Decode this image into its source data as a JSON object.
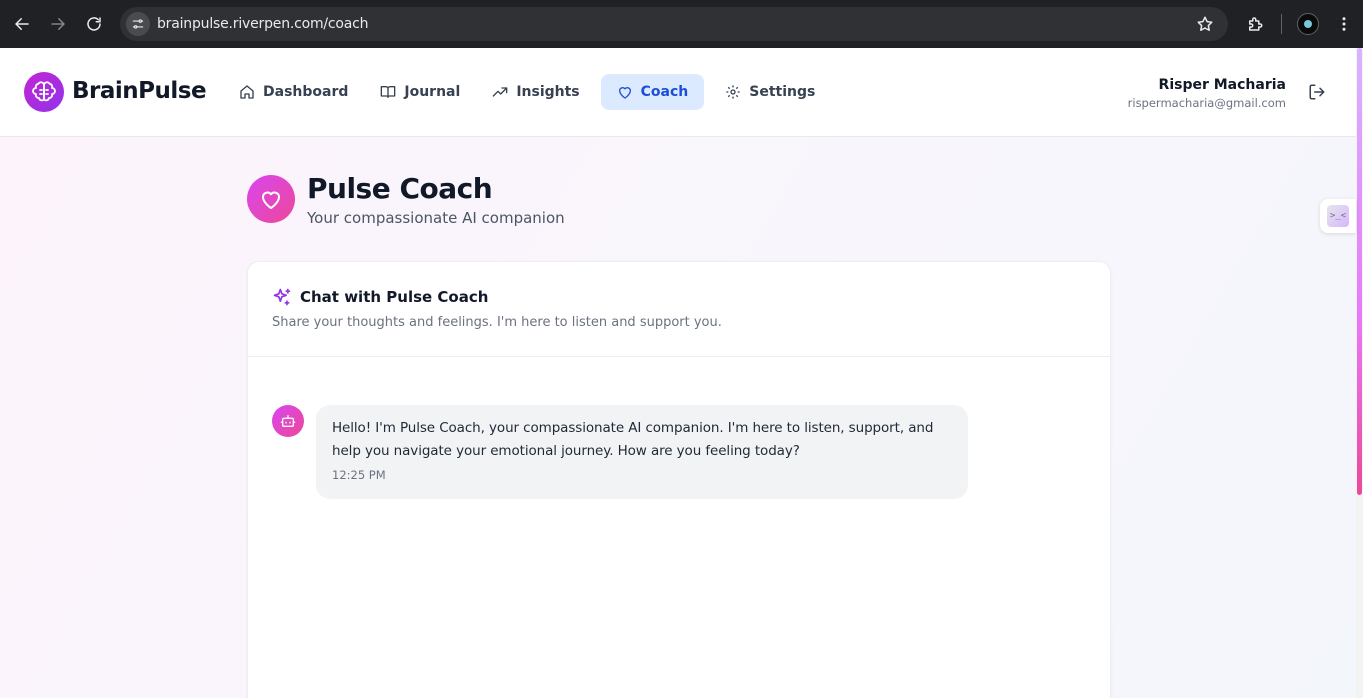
{
  "browser": {
    "url": "brainpulse.riverpen.com/coach"
  },
  "header": {
    "brand": "BrainPulse",
    "nav": [
      {
        "label": "Dashboard",
        "icon": "home-icon"
      },
      {
        "label": "Journal",
        "icon": "book-icon"
      },
      {
        "label": "Insights",
        "icon": "trending-up-icon"
      },
      {
        "label": "Coach",
        "icon": "heart-icon",
        "active": true
      },
      {
        "label": "Settings",
        "icon": "gear-icon"
      }
    ],
    "user": {
      "name": "Risper Macharia",
      "email": "rispermacharia@gmail.com"
    }
  },
  "page": {
    "title": "Pulse Coach",
    "subtitle": "Your compassionate AI companion"
  },
  "chat": {
    "title": "Chat with Pulse Coach",
    "description": "Share your thoughts and feelings. I'm here to listen and support you.",
    "messages": [
      {
        "sender": "bot",
        "text": "Hello! I'm Pulse Coach, your compassionate AI companion. I'm here to listen, support, and help you navigate your emotional journey. How are you feeling today?",
        "time": "12:25 PM"
      }
    ]
  },
  "colors": {
    "accent": "#1d4ed8",
    "active_nav_bg": "#dbeafe",
    "brand_gradient_start": "#d946ef",
    "brand_gradient_end": "#ec4899"
  }
}
